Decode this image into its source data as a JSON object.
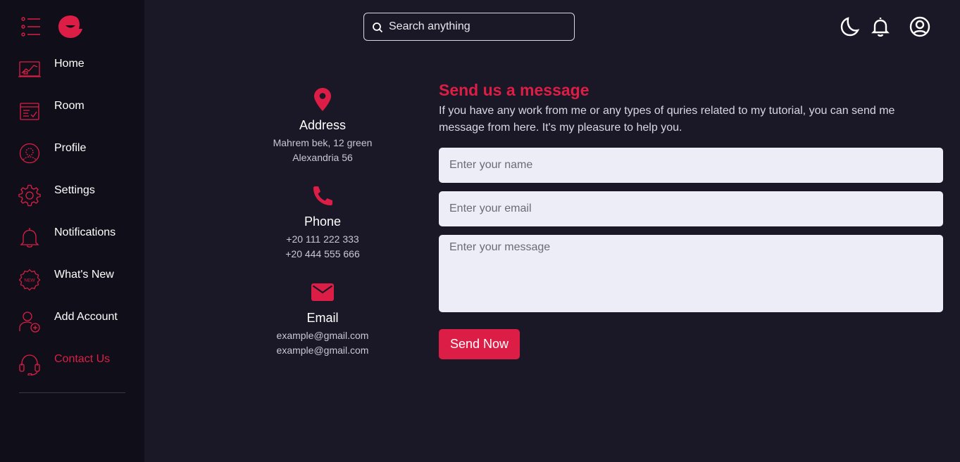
{
  "sidebar": {
    "menu_icon": "list-icon",
    "logo_icon": "chat-bubble-logo",
    "accent_color": "#dc1e46",
    "items": [
      {
        "label": "Home",
        "icon": "monitor-chart-icon",
        "active": false
      },
      {
        "label": "Room",
        "icon": "checklist-board-icon",
        "active": false
      },
      {
        "label": "Profile",
        "icon": "user-circle-icon",
        "active": false
      },
      {
        "label": "Settings",
        "icon": "gear-icon",
        "active": false
      },
      {
        "label": "Notifications",
        "icon": "bell-icon",
        "active": false
      },
      {
        "label": "What's New",
        "icon": "new-badge-icon",
        "active": false
      },
      {
        "label": "Add Account",
        "icon": "add-user-icon",
        "active": false
      },
      {
        "label": "Contact Us",
        "icon": "headset-icon",
        "active": true
      }
    ]
  },
  "header": {
    "search_placeholder": "Search anything",
    "icons": [
      "moon-icon",
      "bell-icon",
      "account-circle-icon"
    ]
  },
  "contact_info": [
    {
      "title": "Address",
      "icon": "location-pin-icon",
      "lines": [
        "Mahrem bek, 12 green",
        "Alexandria 56"
      ]
    },
    {
      "title": "Phone",
      "icon": "phone-icon",
      "lines": [
        "+20 111 222 333",
        "+20 444 555 666"
      ]
    },
    {
      "title": "Email",
      "icon": "envelope-icon",
      "lines": [
        "example@gmail.com",
        "example@gmail.com"
      ]
    }
  ],
  "form": {
    "title": "Send us a message",
    "description": "If you have any work from me or any types of quries related to my tutorial, you can send me message from here. It's my pleasure to help you.",
    "name_placeholder": "Enter your name",
    "email_placeholder": "Enter your email",
    "message_placeholder": "Enter your message",
    "submit_label": "Send Now"
  },
  "colors": {
    "background": "#1a1826",
    "sidebar": "#100e18",
    "accent": "#dc1e46",
    "field": "#ededf8"
  }
}
